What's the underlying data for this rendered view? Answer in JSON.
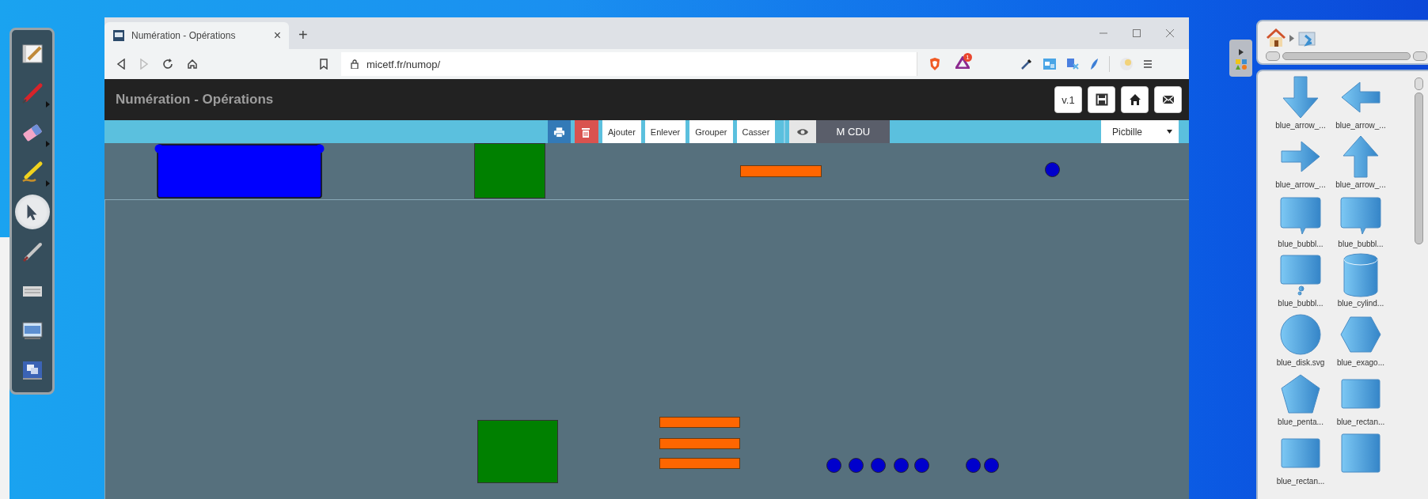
{
  "toolbox": {
    "tools": [
      {
        "kind": "board-pen",
        "selected": false,
        "has_menu": false
      },
      {
        "kind": "pen",
        "selected": false,
        "has_menu": true
      },
      {
        "kind": "eraser",
        "selected": false,
        "has_menu": true
      },
      {
        "kind": "highlighter",
        "selected": false,
        "has_menu": true
      },
      {
        "kind": "select",
        "selected": true,
        "has_menu": false
      },
      {
        "kind": "marker",
        "selected": false,
        "has_menu": false
      },
      {
        "kind": "keyboard",
        "selected": false,
        "has_menu": false
      },
      {
        "kind": "screen",
        "selected": false,
        "has_menu": false
      },
      {
        "kind": "windows",
        "selected": false,
        "has_menu": false
      }
    ]
  },
  "browser": {
    "tab": {
      "title": "Numération - Opérations",
      "close": "×"
    },
    "new_tab": "+",
    "forward_disabled": true,
    "url": "micetf.fr/numop/",
    "rewards_badge": "1"
  },
  "app": {
    "title": "Numération - Opérations",
    "header_buttons": [
      {
        "kind": "text",
        "label": "v.1"
      },
      {
        "kind": "save"
      },
      {
        "kind": "home"
      },
      {
        "kind": "mail"
      }
    ],
    "toolbar": [
      {
        "kind": "print"
      },
      {
        "kind": "delete"
      },
      {
        "kind": "text",
        "label": "Ajouter"
      },
      {
        "kind": "text",
        "label": "Enlever"
      },
      {
        "kind": "text",
        "label": "Grouper"
      },
      {
        "kind": "text",
        "label": "Casser"
      },
      {
        "kind": "eye"
      },
      {
        "kind": "mode",
        "label": "M CDU"
      }
    ],
    "select": {
      "value": "Picbille"
    }
  },
  "library": {
    "items": [
      {
        "kind": "arrow-down",
        "label": "blue_arrow_..."
      },
      {
        "kind": "arrow-left",
        "label": "blue_arrow_..."
      },
      {
        "kind": "arrow-right",
        "label": "blue_arrow_..."
      },
      {
        "kind": "arrow-up",
        "label": "blue_arrow_..."
      },
      {
        "kind": "bubble",
        "label": "blue_bubbl..."
      },
      {
        "kind": "bubble",
        "label": "blue_bubbl..."
      },
      {
        "kind": "thought",
        "label": "blue_bubbl..."
      },
      {
        "kind": "cylinder",
        "label": "blue_cylind..."
      },
      {
        "kind": "disk",
        "label": "blue_disk.svg"
      },
      {
        "kind": "hexagon",
        "label": "blue_exago..."
      },
      {
        "kind": "pentagon",
        "label": "blue_penta..."
      },
      {
        "kind": "rectangle",
        "label": "blue_rectan..."
      },
      {
        "kind": "rectangle",
        "label": "blue_rectan..."
      },
      {
        "kind": "square"
      }
    ]
  }
}
